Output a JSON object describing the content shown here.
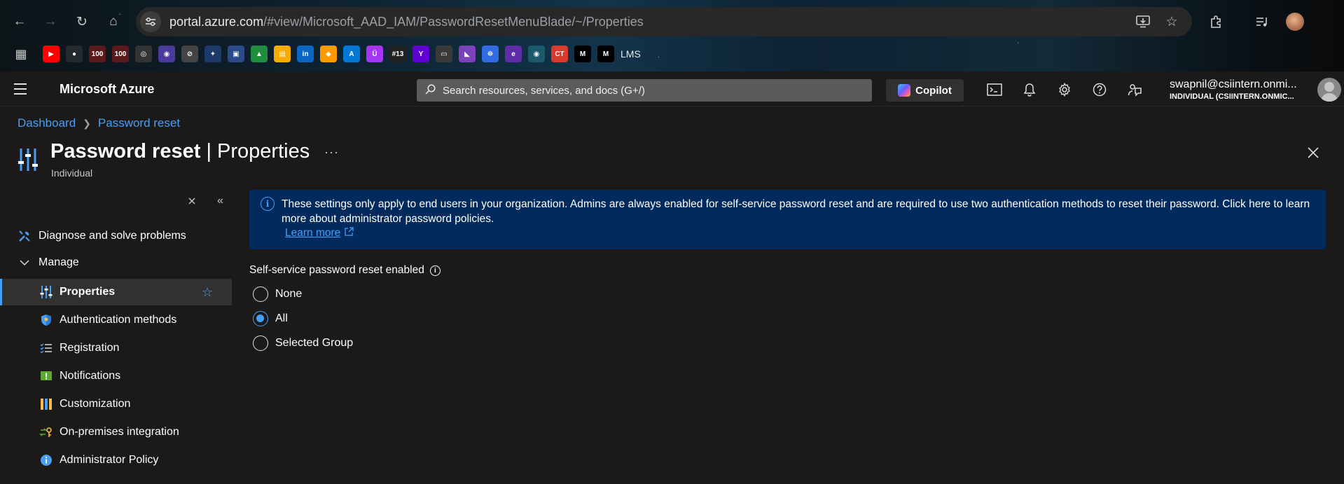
{
  "browser": {
    "url_host": "portal.azure.com",
    "url_path": "/#view/Microsoft_AAD_IAM/PasswordResetMenuBlade/~/Properties",
    "bookmarks": [
      {
        "name": "youtube-bookmark",
        "color": "#ff0000",
        "glyph": "▶"
      },
      {
        "name": "github-bookmark",
        "color": "#24292e",
        "glyph": "●"
      },
      {
        "name": "gmail-100-bookmark",
        "color": "#5a1a1a",
        "glyph": "100"
      },
      {
        "name": "gmail-100b-bookmark",
        "color": "#5a1a1a",
        "glyph": "100"
      },
      {
        "name": "openai-bookmark",
        "color": "#333333",
        "glyph": "◎"
      },
      {
        "name": "paradigm-bookmark",
        "color": "#4a3a9a",
        "glyph": "◉"
      },
      {
        "name": "arc-bookmark",
        "color": "#444444",
        "glyph": "⊘"
      },
      {
        "name": "gemini-bookmark",
        "color": "#1e3a6a",
        "glyph": "✦"
      },
      {
        "name": "profile-bookmark",
        "color": "#2a4a8a",
        "glyph": "▣"
      },
      {
        "name": "drive-bookmark",
        "color": "#1e8e3e",
        "glyph": "▲"
      },
      {
        "name": "classroom-bookmark",
        "color": "#f9ab00",
        "glyph": "▤"
      },
      {
        "name": "linkedin-bookmark",
        "color": "#0a66c2",
        "glyph": "in"
      },
      {
        "name": "aws-bookmark",
        "color": "#ff9900",
        "glyph": "◆"
      },
      {
        "name": "azure-bookmark",
        "color": "#0078d4",
        "glyph": "A"
      },
      {
        "name": "udemy-bookmark",
        "color": "#a435f0",
        "glyph": "Ü"
      },
      {
        "name": "hash13-bookmark",
        "color": "#222222",
        "glyph": "#13"
      },
      {
        "name": "yahoo-bookmark",
        "color": "#6001d2",
        "glyph": "Y"
      },
      {
        "name": "folder-bookmark",
        "color": "#3a3a3a",
        "glyph": "▭"
      },
      {
        "name": "terraform-bookmark",
        "color": "#7b42bc",
        "glyph": "◣"
      },
      {
        "name": "kubernetes-bookmark",
        "color": "#326ce5",
        "glyph": "☸"
      },
      {
        "name": "eclipse-bookmark",
        "color": "#5e2ca5",
        "glyph": "e"
      },
      {
        "name": "eye-bookmark",
        "color": "#1a5a6a",
        "glyph": "◉"
      },
      {
        "name": "ct-bookmark",
        "color": "#d83b2c",
        "glyph": "CT"
      },
      {
        "name": "medium-bookmark",
        "color": "#000000",
        "glyph": "M"
      },
      {
        "name": "medium2-bookmark",
        "color": "#000000",
        "glyph": "M"
      }
    ],
    "lms_label": "LMS"
  },
  "azure": {
    "brand": "Microsoft Azure",
    "search_placeholder": "Search resources, services, and docs (G+/)",
    "copilot_label": "Copilot",
    "user_name": "swapnil@csiintern.onmi...",
    "user_tenant": "INDIVIDUAL (CSIINTERN.ONMIC..."
  },
  "breadcrumb": {
    "root": "Dashboard",
    "current": "Password reset"
  },
  "blade": {
    "title": "Password reset",
    "section": "Properties",
    "subtitle": "Individual",
    "more": "···"
  },
  "sidebar": {
    "top_items": [
      {
        "label": "Diagnose and solve problems"
      },
      {
        "label": "Manage"
      }
    ],
    "items": [
      {
        "label": "Properties"
      },
      {
        "label": "Authentication methods"
      },
      {
        "label": "Registration"
      },
      {
        "label": "Notifications"
      },
      {
        "label": "Customization"
      },
      {
        "label": "On-premises integration"
      },
      {
        "label": "Administrator Policy"
      }
    ]
  },
  "banner": {
    "message": "These settings only apply to end users in your organization. Admins are always enabled for self-service password reset and are required to use two authentication methods to reset their password. Click here to learn more about administrator password policies.",
    "link": "Learn more"
  },
  "sspr": {
    "label": "Self-service password reset enabled",
    "options": [
      "None",
      "All",
      "Selected Group"
    ],
    "selected": "All"
  },
  "colors": {
    "accent": "#479ef5",
    "banner": "#022a5c",
    "background": "#1b1a19"
  }
}
